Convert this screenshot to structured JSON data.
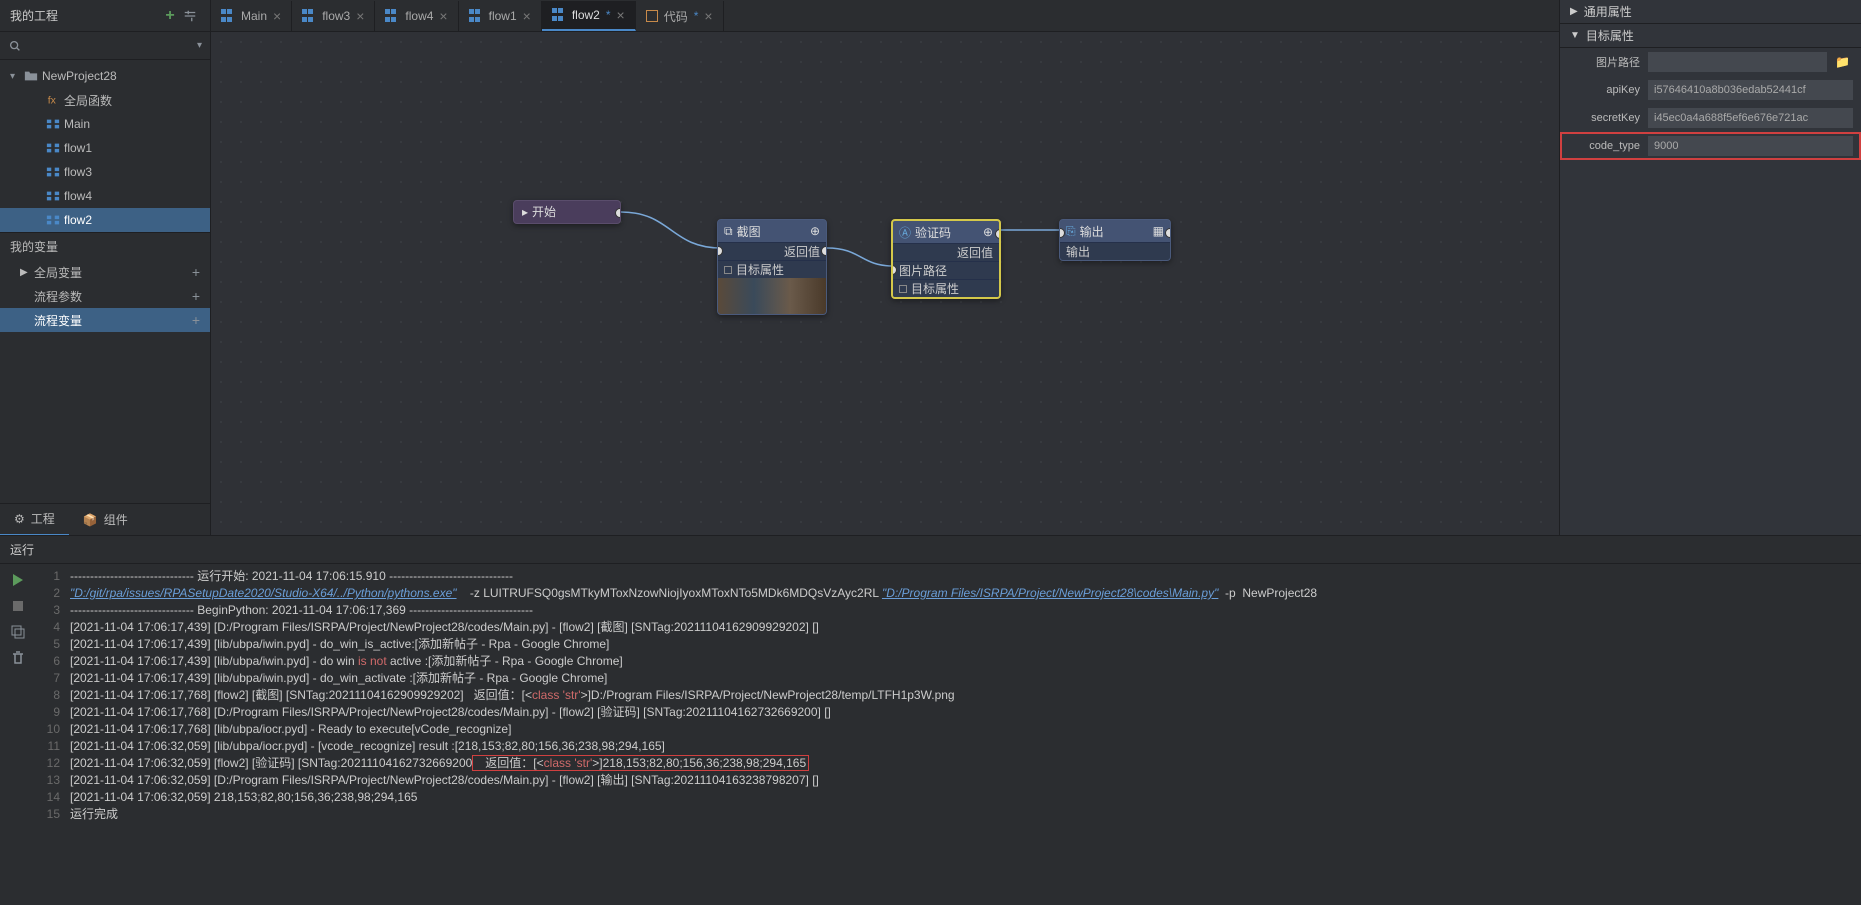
{
  "sidebar": {
    "title": "我的工程",
    "project": "NewProject28",
    "items": [
      {
        "label": "全局函数",
        "ico": "fn"
      },
      {
        "label": "Main",
        "ico": "flow"
      },
      {
        "label": "flow1",
        "ico": "flow"
      },
      {
        "label": "flow3",
        "ico": "flow"
      },
      {
        "label": "flow4",
        "ico": "flow"
      },
      {
        "label": "flow2",
        "ico": "flow",
        "sel": true
      }
    ],
    "vars_title": "我的变量",
    "var_rows": [
      {
        "label": "全局变量",
        "caret": true
      },
      {
        "label": "流程参数"
      },
      {
        "label": "流程变量",
        "sel": true
      }
    ],
    "tabs": [
      {
        "label": "工程",
        "ico": "gear",
        "act": true
      },
      {
        "label": "组件",
        "ico": "pkg"
      }
    ]
  },
  "tabs": [
    {
      "label": "Main",
      "type": "flow"
    },
    {
      "label": "flow3",
      "type": "flow"
    },
    {
      "label": "flow4",
      "type": "flow"
    },
    {
      "label": "flow1",
      "type": "flow"
    },
    {
      "label": "flow2",
      "type": "flow",
      "act": true,
      "mod": true
    },
    {
      "label": "代码",
      "type": "code",
      "mod": true
    }
  ],
  "nodes": {
    "start": {
      "label": "开始"
    },
    "cap": {
      "title": "截图",
      "ret": "返回值",
      "tgt": "目标属性"
    },
    "ver": {
      "title": "验证码",
      "ret": "返回值",
      "img": "图片路径",
      "tgt": "目标属性"
    },
    "out": {
      "title": "输出",
      "port": "输出"
    }
  },
  "right": {
    "sec1": "通用属性",
    "sec2": "目标属性",
    "props": [
      {
        "label": "图片路径",
        "val": "",
        "folder": true
      },
      {
        "label": "apiKey",
        "val": "i57646410a8b036edab52441cf"
      },
      {
        "label": "secretKey",
        "val": "i45ec0a4a688f5ef6e676e721ac"
      },
      {
        "label": "code_type",
        "val": "9000",
        "hl": true
      }
    ]
  },
  "run": {
    "title": "运行"
  },
  "console": [
    {
      "n": 1,
      "segs": [
        {
          "t": "------------------------------- 运行开始: 2021-11-04 17:06:15.910 -------------------------------"
        }
      ]
    },
    {
      "n": 2,
      "segs": [
        {
          "t": "\"D:/git/rpa/issues/RPASetupDate2020/Studio-X64/../Python/pythons.exe\"",
          "c": "lnk"
        },
        {
          "t": "    -z LUITRUFSQ0gsMTkyMToxNzowNiojIyoxMToxNTo5MDk6MDQsVzAyc2RL "
        },
        {
          "t": "\"D:/Program Files/ISRPA/Project/NewProject28\\codes\\Main.py\"",
          "c": "lnk"
        },
        {
          "t": "  -p  NewProject28"
        }
      ]
    },
    {
      "n": 3,
      "segs": [
        {
          "t": "------------------------------- BeginPython: 2021-11-04 17:06:17,369 -------------------------------"
        }
      ]
    },
    {
      "n": 4,
      "segs": [
        {
          "t": "[2021-11-04 17:06:17,439] [D:/Program Files/ISRPA/Project/NewProject28/codes/Main.py] - [flow2] [截图] [SNTag:20211104162909929202] []"
        }
      ]
    },
    {
      "n": 5,
      "segs": [
        {
          "t": "[2021-11-04 17:06:17,439] [lib/ubpa/iwin.pyd] - do_win_is_active:[添加新帖子 - Rpa - Google Chrome]"
        }
      ]
    },
    {
      "n": 6,
      "segs": [
        {
          "t": "[2021-11-04 17:06:17,439] [lib/ubpa/iwin.pyd] - do win "
        },
        {
          "t": "is not",
          "c": "red"
        },
        {
          "t": " active :[添加新帖子 - Rpa - Google Chrome]"
        }
      ]
    },
    {
      "n": 7,
      "segs": [
        {
          "t": "[2021-11-04 17:06:17,439] [lib/ubpa/iwin.pyd] - do_win_activate :[添加新帖子 - Rpa - Google Chrome]"
        }
      ]
    },
    {
      "n": 8,
      "segs": [
        {
          "t": "[2021-11-04 17:06:17,768] [flow2] [截图] [SNTag:20211104162909929202]   返回值：[<"
        },
        {
          "t": "class 'str'",
          "c": "red"
        },
        {
          "t": ">]D:/Program Files/ISRPA/Project/NewProject28/temp/LTFH1p3W.png"
        }
      ]
    },
    {
      "n": 9,
      "segs": [
        {
          "t": "[2021-11-04 17:06:17,768] [D:/Program Files/ISRPA/Project/NewProject28/codes/Main.py] - [flow2] [验证码] [SNTag:20211104162732669200] []"
        }
      ]
    },
    {
      "n": 10,
      "segs": [
        {
          "t": "[2021-11-04 17:06:17,768] [lib/ubpa/iocr.pyd] - Ready to execute[vCode_recognize]"
        }
      ]
    },
    {
      "n": 11,
      "segs": [
        {
          "t": "[2021-11-04 17:06:32,059] [lib/ubpa/iocr.pyd] - [vcode_recognize] result :[218,153;82,80;156,36;238,98;294,165]"
        }
      ]
    },
    {
      "n": 12,
      "segs": [
        {
          "t": "[2021-11-04 17:06:32,059] [flow2] [验证码] [SNTag:20211104162732669200"
        },
        {
          "t": "   返回值：[<",
          "box": true
        },
        {
          "t": "class 'str'",
          "c": "red",
          "box": true
        },
        {
          "t": ">]218,153;82,80;156,36;238,98;294,165",
          "box": true
        }
      ]
    },
    {
      "n": 13,
      "segs": [
        {
          "t": "[2021-11-04 17:06:32,059] [D:/Program Files/ISRPA/Project/NewProject28/codes/Main.py] - [flow2] [输出] [SNTag:20211104163238798207] []"
        }
      ]
    },
    {
      "n": 14,
      "segs": [
        {
          "t": "[2021-11-04 17:06:32,059] 218,153;82,80;156,36;238,98;294,165"
        }
      ]
    },
    {
      "n": 15,
      "segs": [
        {
          "t": "运行完成"
        }
      ]
    }
  ]
}
